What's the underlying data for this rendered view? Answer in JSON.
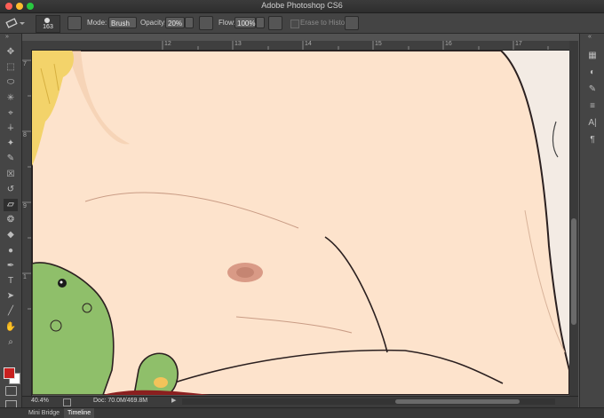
{
  "window": {
    "title": "Adobe Photoshop CS6"
  },
  "options_bar": {
    "brush_size": "163",
    "mode_label": "Mode:",
    "mode_value": "Brush",
    "opacity_label": "Opacity:",
    "opacity_value": "20%",
    "flow_label": "Flow:",
    "flow_value": "100%",
    "erase_to_history_label": "Erase to History"
  },
  "ruler": {
    "top_ticks": [
      "12",
      "13",
      "14",
      "15",
      "16",
      "17"
    ],
    "left_ticks": [
      "7",
      "8",
      "9",
      "1"
    ]
  },
  "status": {
    "zoom": "40.4%",
    "doc_info": "Doc: 70.0M/469.8M"
  },
  "bottom_tabs": [
    "Mini Bridge",
    "Timeline"
  ],
  "colors": {
    "foreground": "#c8201f",
    "background": "#ffffff",
    "skin": "#fde3cc",
    "frog": "#8fbf6a",
    "hair": "#f3d36a"
  },
  "icons": {
    "tools": [
      "move-icon",
      "marquee-icon",
      "lasso-icon",
      "quick-select-icon",
      "crop-icon",
      "eyedropper-icon",
      "healing-brush-icon",
      "brush-icon",
      "clone-stamp-icon",
      "history-brush-icon",
      "eraser-icon",
      "paint-bucket-icon",
      "blur-icon",
      "dodge-icon",
      "pen-icon",
      "type-icon",
      "path-select-icon",
      "line-icon",
      "hand-icon",
      "zoom-icon"
    ],
    "panels": [
      "color-panel-icon",
      "adjustments-panel-icon",
      "brush-panel-icon",
      "brush-presets-icon",
      "character-panel-icon",
      "paragraph-panel-icon"
    ]
  }
}
